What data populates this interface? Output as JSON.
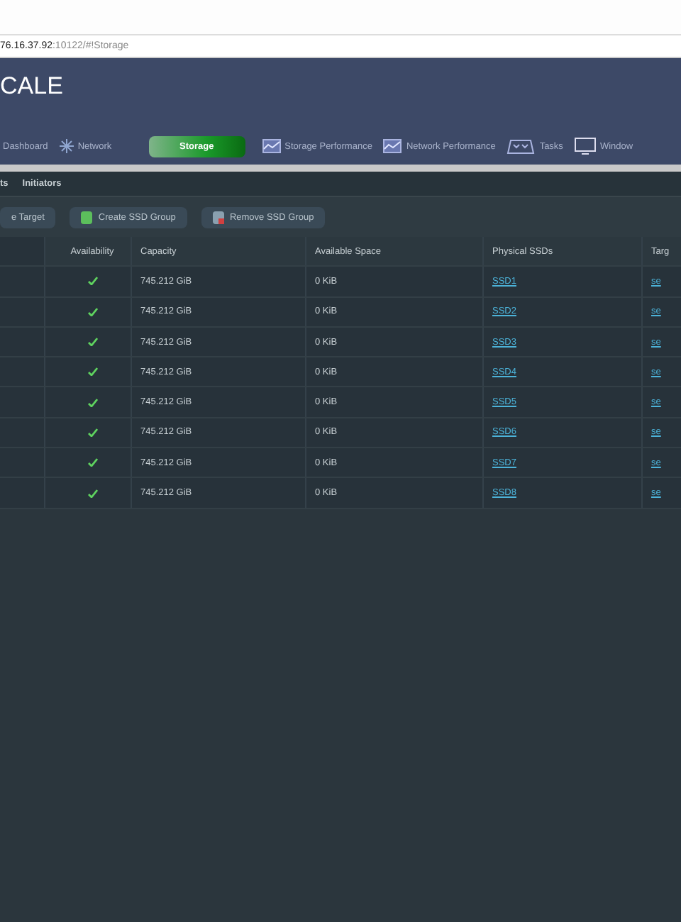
{
  "address_bar": {
    "host": "76.16.37.92",
    "path": ":10122/#!Storage"
  },
  "header": {
    "logo": "CALE"
  },
  "nav": [
    {
      "label": "Dashboard",
      "selected": false,
      "kind": "plain"
    },
    {
      "label": "Network",
      "selected": false,
      "kind": "network"
    },
    {
      "label": "Storage",
      "selected": true,
      "kind": "plain"
    },
    {
      "label": "Storage Performance",
      "selected": false,
      "kind": "chart"
    },
    {
      "label": "Network Performance",
      "selected": false,
      "kind": "chart"
    },
    {
      "label": "Tasks",
      "selected": false,
      "kind": "tasks"
    },
    {
      "label": "Window",
      "selected": false,
      "kind": "monitor"
    }
  ],
  "tabs": [
    {
      "label": "ts",
      "selected": false
    },
    {
      "label": "Initiators",
      "selected": false
    }
  ],
  "toolbar": [
    {
      "label": "e Target",
      "kind": "plain"
    },
    {
      "label": "Create SSD Group",
      "kind": "add"
    },
    {
      "label": "Remove SSD Group",
      "kind": "remove"
    }
  ],
  "table": {
    "columns": [
      "Availability",
      "Capacity",
      "Available Space",
      "Physical SSDs",
      "Targ"
    ],
    "rows": [
      {
        "available": true,
        "capacity": "745.212 GiB",
        "available_space": "0 KiB",
        "ssd": "SSD1",
        "target": "se"
      },
      {
        "available": true,
        "capacity": "745.212 GiB",
        "available_space": "0 KiB",
        "ssd": "SSD2",
        "target": "se"
      },
      {
        "available": true,
        "capacity": "745.212 GiB",
        "available_space": "0 KiB",
        "ssd": "SSD3",
        "target": "se"
      },
      {
        "available": true,
        "capacity": "745.212 GiB",
        "available_space": "0 KiB",
        "ssd": "SSD4",
        "target": "se"
      },
      {
        "available": true,
        "capacity": "745.212 GiB",
        "available_space": "0 KiB",
        "ssd": "SSD5",
        "target": "se"
      },
      {
        "available": true,
        "capacity": "745.212 GiB",
        "available_space": "0 KiB",
        "ssd": "SSD6",
        "target": "se"
      },
      {
        "available": true,
        "capacity": "745.212 GiB",
        "available_space": "0 KiB",
        "ssd": "SSD7",
        "target": "se"
      },
      {
        "available": true,
        "capacity": "745.212 GiB",
        "available_space": "0 KiB",
        "ssd": "SSD8",
        "target": "se"
      }
    ]
  }
}
